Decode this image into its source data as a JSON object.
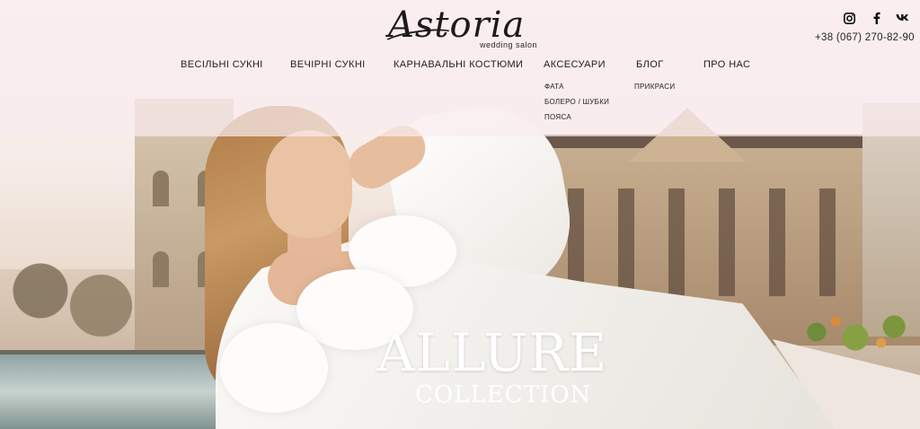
{
  "brand": {
    "logo_text": "Astoria",
    "logo_sub": "wedding salon"
  },
  "contact": {
    "phone": "+38 (067) 270-82-90"
  },
  "social": [
    {
      "name": "instagram-icon"
    },
    {
      "name": "facebook-icon"
    },
    {
      "name": "vk-icon"
    }
  ],
  "nav": {
    "items": [
      {
        "label": "ВЕСІЛЬНІ СУКНІ"
      },
      {
        "label": "ВЕЧІРНІ СУКНІ"
      },
      {
        "label": "КАРНАВАЛЬНІ КОСТЮМИ"
      },
      {
        "label": "АКСЕСУАРИ"
      },
      {
        "label": "БЛОГ"
      },
      {
        "label": "ПРО НАС"
      }
    ],
    "accessories_sub": [
      "ФАТА",
      "БОЛЕРО / ШУБКИ",
      "ПОЯСА"
    ],
    "blog_sub": [
      "ПРИКРАСИ"
    ]
  },
  "hero": {
    "title": "ALLURE",
    "subtitle": "COLLECTION"
  }
}
